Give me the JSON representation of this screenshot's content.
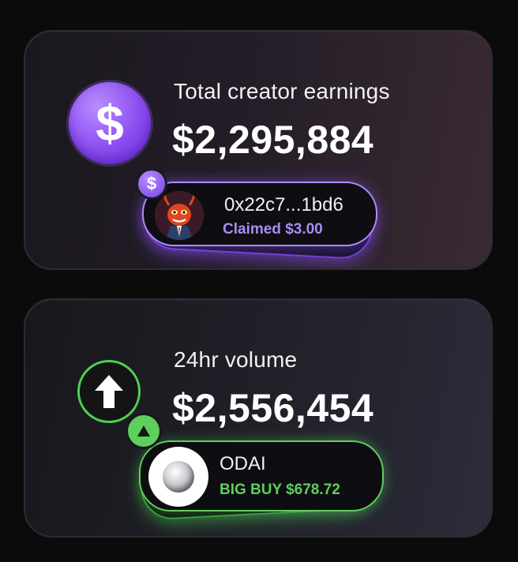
{
  "colors": {
    "earnings_accent": "#8a4df0",
    "earnings_sub_text": "#a98bf5",
    "volume_accent": "#5fcf5c",
    "background": "#0b0b0c"
  },
  "earnings_card": {
    "title": "Total creator earnings",
    "value": "$2,295,884",
    "icon": "dollar-icon",
    "icon_glyph": "$",
    "activity": {
      "badge_glyph": "$",
      "name": "0x22c7...1bd6",
      "status": "Claimed $3.00",
      "avatar": "creator-avatar"
    }
  },
  "volume_card": {
    "title": "24hr volume",
    "value": "$2,556,454",
    "icon": "arrow-up-icon",
    "activity": {
      "name": "ODAI",
      "status": "BIG BUY $678.72",
      "avatar": "token-avatar",
      "badge_icon": "triangle-up-icon"
    }
  }
}
